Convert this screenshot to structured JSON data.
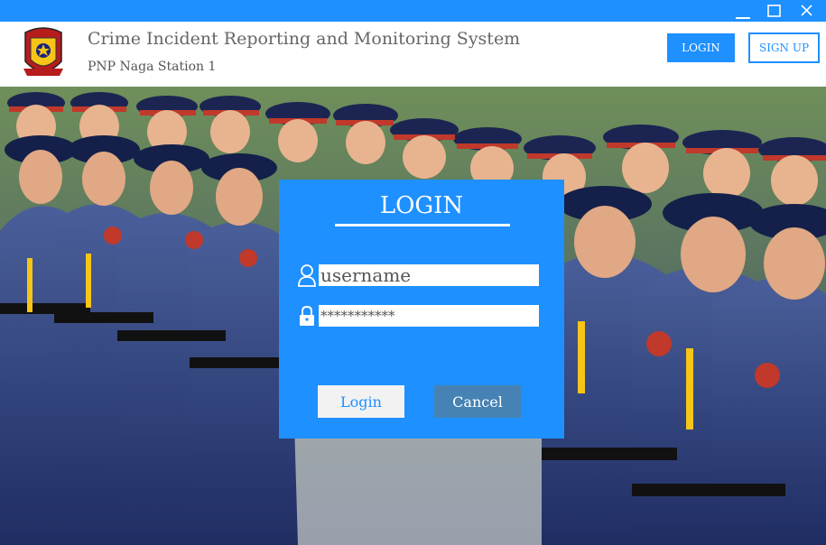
{
  "window": {
    "controls": [
      "minimize-icon",
      "maximize-icon",
      "close-icon"
    ],
    "accent_color": "#1e90ff"
  },
  "header": {
    "title": "Crime Incident Reporting and Monitoring System",
    "subtitle": "PNP Naga Station 1",
    "login_label": "LOGIN",
    "signup_label": "SIGN UP",
    "logo_icon": "pnp-badge-logo"
  },
  "login_card": {
    "title": "LOGIN",
    "username_value": "username",
    "password_value": "***********",
    "login_button": "Login",
    "cancel_button": "Cancel",
    "username_icon": "user-icon",
    "password_icon": "lock-icon"
  },
  "background": {
    "description_icon": "police-officers-photo"
  }
}
